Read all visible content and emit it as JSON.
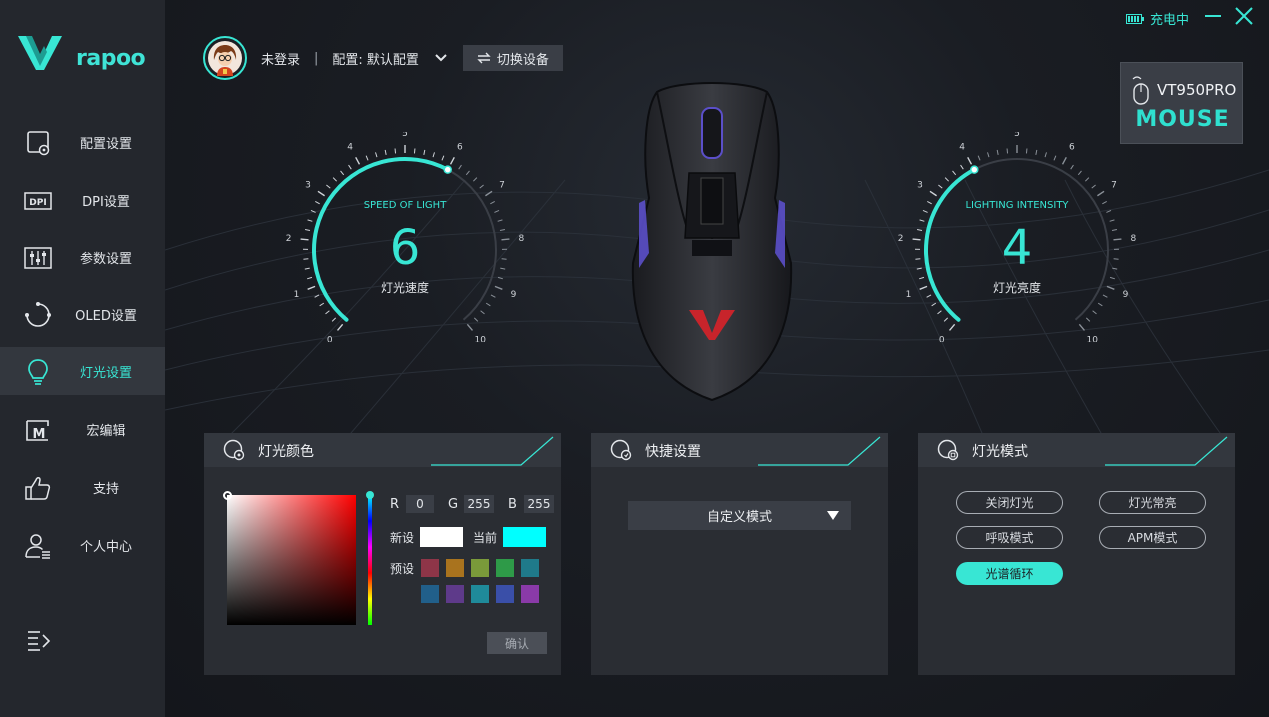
{
  "app": {
    "brand": "rapoo"
  },
  "sidebar": {
    "items": [
      {
        "label": "配置设置",
        "icon": "profile-settings-icon"
      },
      {
        "label": "DPI设置",
        "icon": "dpi-icon"
      },
      {
        "label": "参数设置",
        "icon": "sliders-icon"
      },
      {
        "label": "OLED设置",
        "icon": "oled-refresh-icon"
      },
      {
        "label": "灯光设置",
        "icon": "bulb-icon",
        "active": true
      },
      {
        "label": "宏编辑",
        "icon": "macro-icon"
      },
      {
        "label": "支持",
        "icon": "thumbs-up-icon"
      },
      {
        "label": "个人中心",
        "icon": "user-center-icon"
      }
    ]
  },
  "topbar": {
    "charge_status": "充电中"
  },
  "userbar": {
    "username": "未登录",
    "separator": "|",
    "config_label": "配置: 默认配置",
    "switch_device": "切换设备"
  },
  "device": {
    "model": "VT950PRO",
    "type": "MOUSE"
  },
  "gauges": {
    "speed": {
      "caption": "SPEED OF LIGHT",
      "value": "6",
      "label": "灯光速度",
      "min": 0,
      "max": 10,
      "current": 6
    },
    "intensity": {
      "caption": "LIGHTING INTENSITY",
      "value": "4",
      "label": "灯光亮度",
      "min": 0,
      "max": 10,
      "current": 4
    }
  },
  "color_panel": {
    "title": "灯光颜色",
    "r_label": "R",
    "r": "0",
    "g_label": "G",
    "g": "255",
    "b_label": "B",
    "b": "255",
    "new_label": "新设",
    "current_label": "当前",
    "preset_label": "预设",
    "confirm": "确认",
    "new_color": "#ffffff",
    "current_color": "#00ffff",
    "preset_colors": [
      "#8e3548",
      "#a9731e",
      "#7a9a3a",
      "#2e9a48",
      "#1f7a8a",
      "#215f8a",
      "#5e3a8a",
      "#1f8a9a",
      "#3a4fa8",
      "#8a3aa8"
    ]
  },
  "quick_panel": {
    "title": "快捷设置",
    "selected": "自定义模式"
  },
  "mode_panel": {
    "title": "灯光模式",
    "modes": [
      "关闭灯光",
      "灯光常亮",
      "呼吸模式",
      "APM模式",
      "光谱循环"
    ],
    "active": "光谱循环"
  },
  "colors": {
    "accent": "#38e6d4",
    "sidebar_bg": "#24272d",
    "panel_bg": "#2a2d33"
  }
}
